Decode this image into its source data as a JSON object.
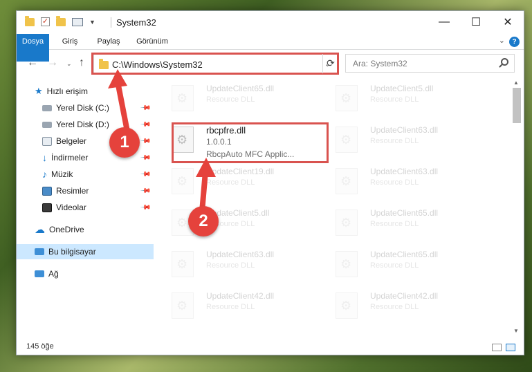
{
  "window": {
    "title": "System32",
    "colors": {
      "accent": "#1979ca",
      "highlight": "#d9534f",
      "selection": "#cce8ff"
    }
  },
  "ribbon": {
    "tabs": [
      "Dosya",
      "Giriş",
      "Paylaş",
      "Görünüm"
    ],
    "help_label": "?"
  },
  "addressbar": {
    "path": "C:\\Windows\\System32",
    "search_placeholder": "Ara: System32"
  },
  "nav": {
    "quick_access": "Hızlı erişim",
    "items": [
      {
        "label": "Yerel Disk (C:)",
        "icon": "drive-icon",
        "pinned": true
      },
      {
        "label": "Yerel Disk (D:)",
        "icon": "drive-icon",
        "pinned": true
      },
      {
        "label": "Belgeler",
        "icon": "document-icon",
        "pinned": true
      },
      {
        "label": "İndirmeler",
        "icon": "download-icon",
        "pinned": true
      },
      {
        "label": "Müzik",
        "icon": "music-icon",
        "pinned": true
      },
      {
        "label": "Resimler",
        "icon": "picture-icon",
        "pinned": true
      },
      {
        "label": "Videolar",
        "icon": "video-icon",
        "pinned": true
      }
    ],
    "onedrive": "OneDrive",
    "this_pc": "Bu bilgisayar",
    "network": "Ağ"
  },
  "files": {
    "selected": {
      "name": "rbcpfre.dll",
      "version": "1.0.0.1",
      "description": "RbcpAuto MFC Applic..."
    },
    "faded": [
      {
        "name": "UpdateClient65.dll",
        "desc": "Resource DLL"
      },
      {
        "name": "UpdateClient5.dll",
        "desc": "Resource DLL"
      },
      {
        "name": "UpdateClient63.dll",
        "desc": "Resource DLL"
      },
      {
        "name": "UpdateClient19.dll",
        "desc": "Resource DLL"
      },
      {
        "name": "UpdateClient63.dll",
        "desc": "Resource DLL"
      },
      {
        "name": "UpdateClient5.dll",
        "desc": "Resource DLL"
      },
      {
        "name": "UpdateClient65.dll",
        "desc": "Resource DLL"
      },
      {
        "name": "UpdateClient63.dll",
        "desc": "Resource DLL"
      },
      {
        "name": "UpdateClient65.dll",
        "desc": "Resource DLL"
      },
      {
        "name": "UpdateClient42.dll",
        "desc": "Resource DLL"
      },
      {
        "name": "UpdateClient42.dll",
        "desc": "Resource DLL"
      }
    ]
  },
  "status": {
    "count": "145 öğe"
  },
  "annotations": {
    "marker1": "1",
    "marker2": "2"
  }
}
